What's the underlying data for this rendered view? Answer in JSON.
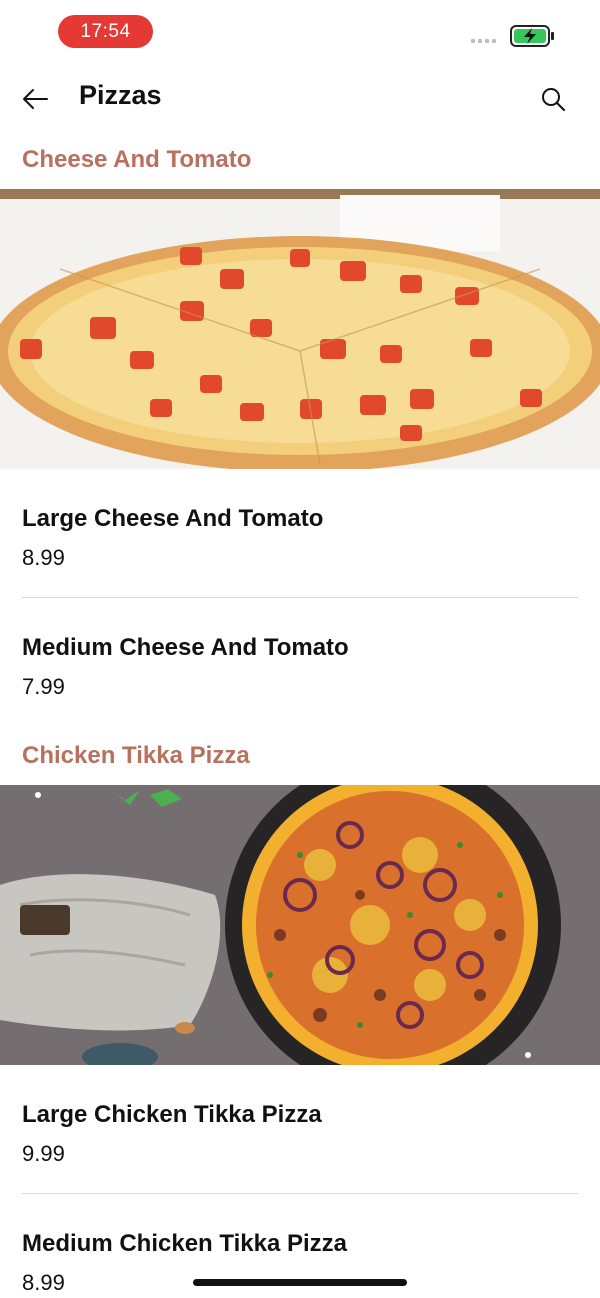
{
  "status_bar": {
    "time": "17:54"
  },
  "header": {
    "title": "Pizzas"
  },
  "icons": {
    "back": "arrow-left-icon",
    "search": "search-icon",
    "battery": "battery-charging-icon"
  },
  "colors": {
    "accent": "#e53935",
    "section": "#b8705f",
    "battery": "#34c759"
  },
  "sections": [
    {
      "title": "Cheese And Tomato",
      "items": [
        {
          "name": "Large Cheese And Tomato",
          "price": "8.99"
        },
        {
          "name": "Medium Cheese And Tomato",
          "price": "7.99"
        }
      ]
    },
    {
      "title": "Chicken Tikka Pizza",
      "items": [
        {
          "name": "Large Chicken Tikka Pizza",
          "price": "9.99"
        },
        {
          "name": "Medium Chicken Tikka Pizza",
          "price": "8.99"
        }
      ]
    }
  ]
}
